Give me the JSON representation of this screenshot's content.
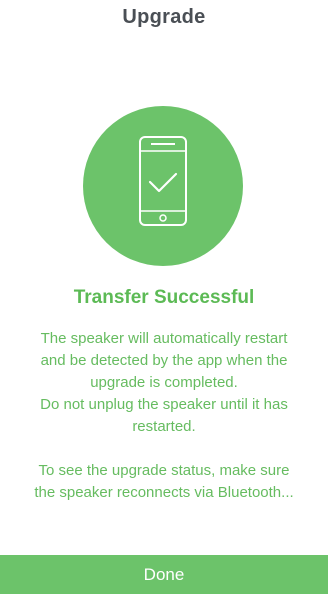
{
  "header": {
    "title": "Upgrade"
  },
  "status": {
    "icon": "phone-check-icon",
    "headline": "Transfer Successful",
    "paragraph1": [
      "The speaker will automatically restart",
      "and be detected by the app when the",
      "upgrade  is completed.",
      "Do not unplug the speaker until it has",
      "restarted."
    ],
    "paragraph2": [
      "To see the upgrade status, make sure",
      "the speaker reconnects via Bluetooth..."
    ]
  },
  "footer": {
    "done_label": "Done"
  },
  "colors": {
    "accent": "#6cc36a",
    "title": "#4a4f55",
    "text": "#66bc60"
  }
}
